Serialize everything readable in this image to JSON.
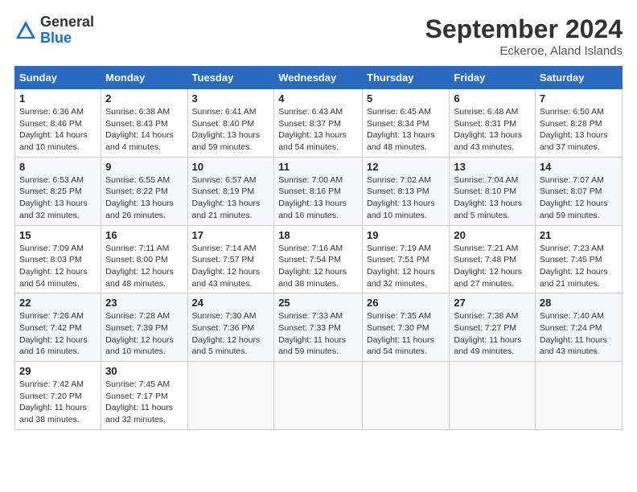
{
  "header": {
    "logo_general": "General",
    "logo_blue": "Blue",
    "month_year": "September 2024",
    "location": "Eckeroe, Aland Islands"
  },
  "days_of_week": [
    "Sunday",
    "Monday",
    "Tuesday",
    "Wednesday",
    "Thursday",
    "Friday",
    "Saturday"
  ],
  "weeks": [
    [
      {
        "day": "1",
        "sunrise": "6:36 AM",
        "sunset": "8:46 PM",
        "daylight": "14 hours and 10 minutes."
      },
      {
        "day": "2",
        "sunrise": "6:38 AM",
        "sunset": "8:43 PM",
        "daylight": "14 hours and 4 minutes."
      },
      {
        "day": "3",
        "sunrise": "6:41 AM",
        "sunset": "8:40 PM",
        "daylight": "13 hours and 59 minutes."
      },
      {
        "day": "4",
        "sunrise": "6:43 AM",
        "sunset": "8:37 PM",
        "daylight": "13 hours and 54 minutes."
      },
      {
        "day": "5",
        "sunrise": "6:45 AM",
        "sunset": "8:34 PM",
        "daylight": "13 hours and 48 minutes."
      },
      {
        "day": "6",
        "sunrise": "6:48 AM",
        "sunset": "8:31 PM",
        "daylight": "13 hours and 43 minutes."
      },
      {
        "day": "7",
        "sunrise": "6:50 AM",
        "sunset": "8:28 PM",
        "daylight": "13 hours and 37 minutes."
      }
    ],
    [
      {
        "day": "8",
        "sunrise": "6:53 AM",
        "sunset": "8:25 PM",
        "daylight": "13 hours and 32 minutes."
      },
      {
        "day": "9",
        "sunrise": "6:55 AM",
        "sunset": "8:22 PM",
        "daylight": "13 hours and 26 minutes."
      },
      {
        "day": "10",
        "sunrise": "6:57 AM",
        "sunset": "8:19 PM",
        "daylight": "13 hours and 21 minutes."
      },
      {
        "day": "11",
        "sunrise": "7:00 AM",
        "sunset": "8:16 PM",
        "daylight": "13 hours and 16 minutes."
      },
      {
        "day": "12",
        "sunrise": "7:02 AM",
        "sunset": "8:13 PM",
        "daylight": "13 hours and 10 minutes."
      },
      {
        "day": "13",
        "sunrise": "7:04 AM",
        "sunset": "8:10 PM",
        "daylight": "13 hours and 5 minutes."
      },
      {
        "day": "14",
        "sunrise": "7:07 AM",
        "sunset": "8:07 PM",
        "daylight": "12 hours and 59 minutes."
      }
    ],
    [
      {
        "day": "15",
        "sunrise": "7:09 AM",
        "sunset": "8:03 PM",
        "daylight": "12 hours and 54 minutes."
      },
      {
        "day": "16",
        "sunrise": "7:11 AM",
        "sunset": "8:00 PM",
        "daylight": "12 hours and 48 minutes."
      },
      {
        "day": "17",
        "sunrise": "7:14 AM",
        "sunset": "7:57 PM",
        "daylight": "12 hours and 43 minutes."
      },
      {
        "day": "18",
        "sunrise": "7:16 AM",
        "sunset": "7:54 PM",
        "daylight": "12 hours and 38 minutes."
      },
      {
        "day": "19",
        "sunrise": "7:19 AM",
        "sunset": "7:51 PM",
        "daylight": "12 hours and 32 minutes."
      },
      {
        "day": "20",
        "sunrise": "7:21 AM",
        "sunset": "7:48 PM",
        "daylight": "12 hours and 27 minutes."
      },
      {
        "day": "21",
        "sunrise": "7:23 AM",
        "sunset": "7:45 PM",
        "daylight": "12 hours and 21 minutes."
      }
    ],
    [
      {
        "day": "22",
        "sunrise": "7:26 AM",
        "sunset": "7:42 PM",
        "daylight": "12 hours and 16 minutes."
      },
      {
        "day": "23",
        "sunrise": "7:28 AM",
        "sunset": "7:39 PM",
        "daylight": "12 hours and 10 minutes."
      },
      {
        "day": "24",
        "sunrise": "7:30 AM",
        "sunset": "7:36 PM",
        "daylight": "12 hours and 5 minutes."
      },
      {
        "day": "25",
        "sunrise": "7:33 AM",
        "sunset": "7:33 PM",
        "daylight": "11 hours and 59 minutes."
      },
      {
        "day": "26",
        "sunrise": "7:35 AM",
        "sunset": "7:30 PM",
        "daylight": "11 hours and 54 minutes."
      },
      {
        "day": "27",
        "sunrise": "7:38 AM",
        "sunset": "7:27 PM",
        "daylight": "11 hours and 49 minutes."
      },
      {
        "day": "28",
        "sunrise": "7:40 AM",
        "sunset": "7:24 PM",
        "daylight": "11 hours and 43 minutes."
      }
    ],
    [
      {
        "day": "29",
        "sunrise": "7:42 AM",
        "sunset": "7:20 PM",
        "daylight": "11 hours and 38 minutes."
      },
      {
        "day": "30",
        "sunrise": "7:45 AM",
        "sunset": "7:17 PM",
        "daylight": "11 hours and 32 minutes."
      },
      null,
      null,
      null,
      null,
      null
    ]
  ]
}
